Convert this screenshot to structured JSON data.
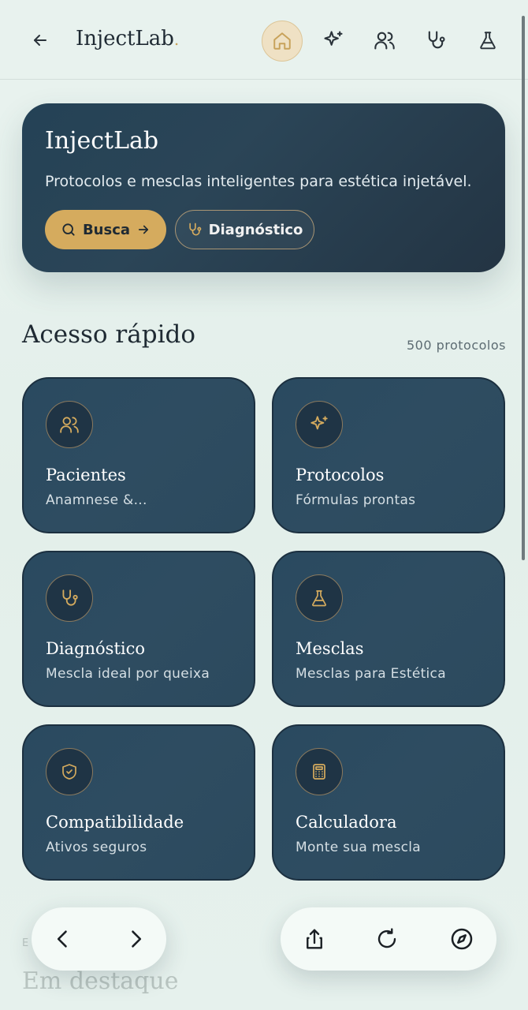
{
  "header": {
    "brand": "InjectLab",
    "brand_dot": "."
  },
  "hero": {
    "title": "InjectLab",
    "subtitle": "Protocolos e mesclas inteligentes para estética injetável.",
    "busca_label": "Busca",
    "diagnostico_label": "Diagnóstico"
  },
  "quick": {
    "title": "Acesso rápido",
    "count": "500 protocolos",
    "cards": [
      {
        "title": "Pacientes",
        "sub": "Anamnese &..."
      },
      {
        "title": "Protocolos",
        "sub": "Fórmulas prontas"
      },
      {
        "title": "Diagnóstico",
        "sub": "Mescla ideal por queixa"
      },
      {
        "title": "Mesclas",
        "sub": "Mesclas para Estética"
      },
      {
        "title": "Compatibilidade",
        "sub": "Ativos seguros"
      },
      {
        "title": "Calculadora",
        "sub": "Monte sua mescla"
      }
    ]
  },
  "featured": {
    "label": "E",
    "title": "Em destaque"
  },
  "colors": {
    "accent_gold": "#d5ab5e",
    "card_bg": "#2c4a5e",
    "page_bg": "#e6f1ed"
  }
}
